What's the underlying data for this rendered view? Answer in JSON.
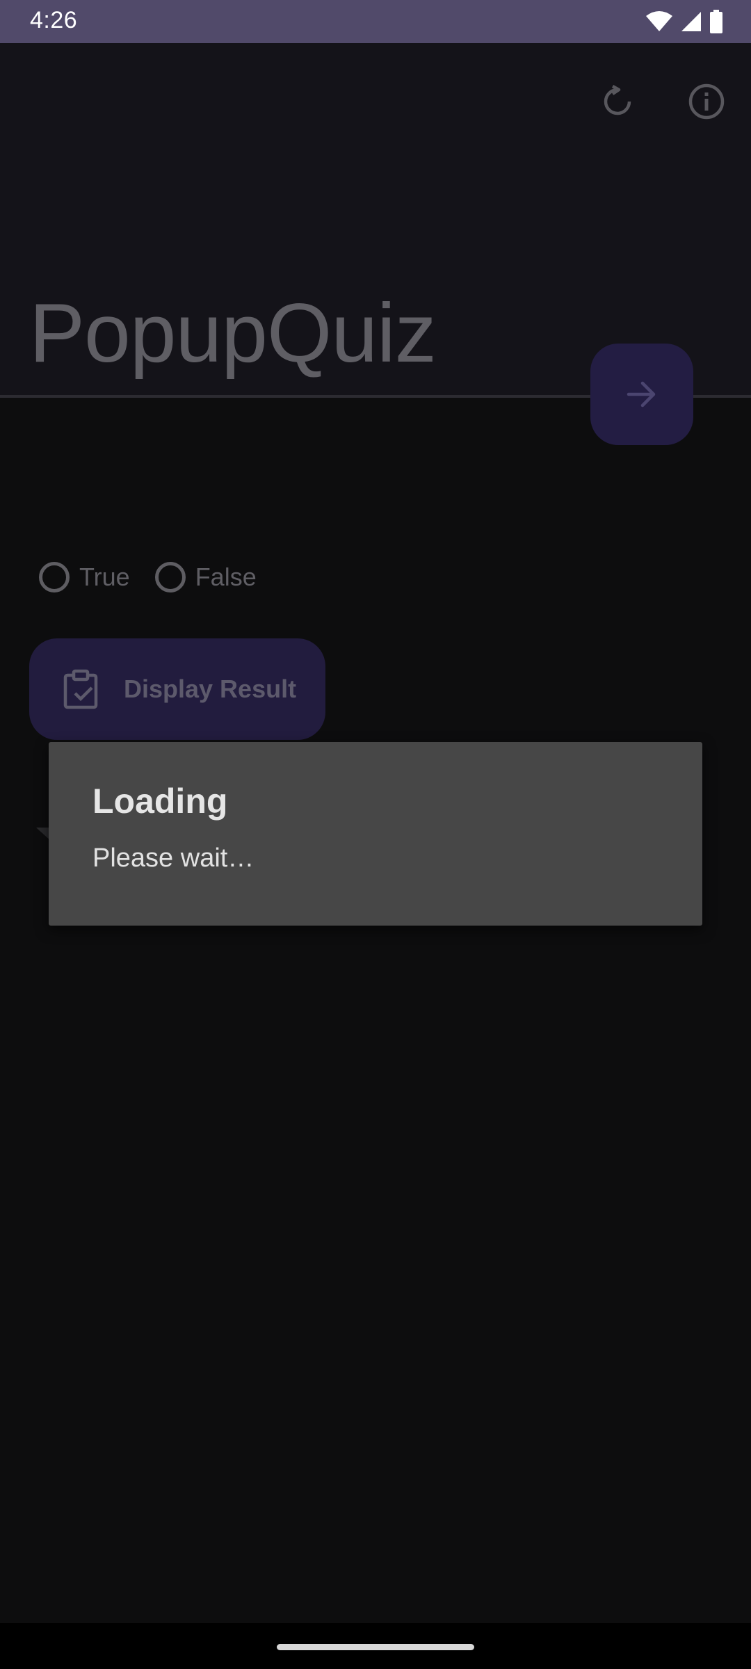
{
  "status_bar": {
    "time": "4:26",
    "icons": [
      "wifi-icon",
      "signal-icon",
      "battery-icon"
    ]
  },
  "app_bar": {
    "title": "PopupQuiz",
    "actions": [
      "reset-icon",
      "info-icon"
    ]
  },
  "quiz": {
    "options": [
      {
        "label": "True",
        "selected": false
      },
      {
        "label": "False",
        "selected": false
      }
    ],
    "result_button_label": "Display Result",
    "next_button_icon": "arrow-right-icon"
  },
  "dialog": {
    "title": "Loading",
    "message": "Please wait…"
  },
  "colors": {
    "status_bar": "#514a6a",
    "app_bar": "#141319",
    "accent_button": "#231d43",
    "dialog": "#474747"
  }
}
